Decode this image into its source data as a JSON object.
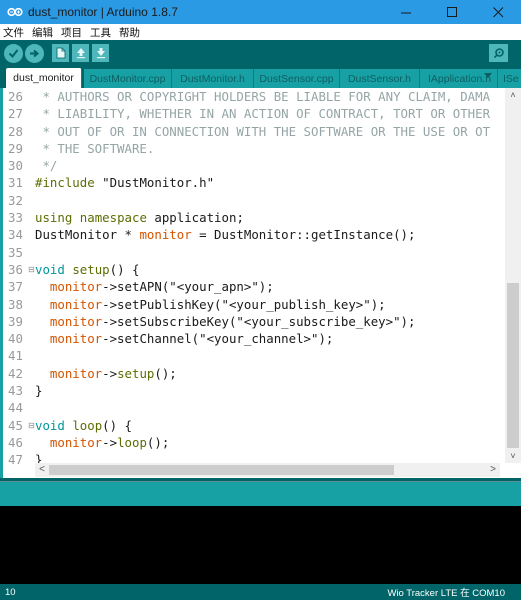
{
  "window": {
    "title": "dust_monitor | Arduino 1.8.7",
    "icon": "arduino-infinity-icon",
    "controls": {
      "minimize": "–",
      "maximize": "☐",
      "close": "✕"
    }
  },
  "menu": {
    "items": [
      "文件",
      "编辑",
      "项目",
      "工具",
      "帮助"
    ]
  },
  "toolbar": {
    "buttons": [
      {
        "name": "verify",
        "icon": "check-icon"
      },
      {
        "name": "upload",
        "icon": "arrow-right-icon"
      },
      {
        "name": "new",
        "icon": "file-icon"
      },
      {
        "name": "open",
        "icon": "arrow-up-icon"
      },
      {
        "name": "save",
        "icon": "arrow-down-icon"
      }
    ],
    "serial_monitor_icon": "magnifier-icon"
  },
  "tabs": [
    {
      "label": "dust_monitor",
      "active": true
    },
    {
      "label": "DustMonitor.cpp",
      "active": false
    },
    {
      "label": "DustMonitor.h",
      "active": false
    },
    {
      "label": "DustSensor.cpp",
      "active": false
    },
    {
      "label": "DustSensor.h",
      "active": false
    },
    {
      "label": "IApplication.h",
      "active": false
    },
    {
      "label": "ISe",
      "active": false
    }
  ],
  "editor": {
    "lines": [
      {
        "n": "26",
        "fold": false,
        "segs": [
          [
            "c-comment",
            " * AUTHORS OR COPYRIGHT HOLDERS BE LIABLE FOR ANY CLAIM, DAMA"
          ]
        ]
      },
      {
        "n": "27",
        "fold": false,
        "segs": [
          [
            "c-comment",
            " * LIABILITY, WHETHER IN AN ACTION OF CONTRACT, TORT OR OTHER"
          ]
        ]
      },
      {
        "n": "28",
        "fold": false,
        "segs": [
          [
            "c-comment",
            " * OUT OF OR IN CONNECTION WITH THE SOFTWARE OR THE USE OR OT"
          ]
        ]
      },
      {
        "n": "29",
        "fold": false,
        "segs": [
          [
            "c-comment",
            " * THE SOFTWARE."
          ]
        ]
      },
      {
        "n": "30",
        "fold": false,
        "segs": [
          [
            "c-comment",
            " */"
          ]
        ]
      },
      {
        "n": "31",
        "fold": false,
        "segs": [
          [
            "c-inc",
            "#include"
          ],
          [
            "c-plain",
            " \"DustMonitor.h\""
          ]
        ]
      },
      {
        "n": "32",
        "fold": false,
        "segs": []
      },
      {
        "n": "33",
        "fold": false,
        "segs": [
          [
            "c-inc",
            "using"
          ],
          [
            "c-plain",
            " "
          ],
          [
            "c-inc",
            "namespace"
          ],
          [
            "c-plain",
            " application;"
          ]
        ]
      },
      {
        "n": "34",
        "fold": false,
        "segs": [
          [
            "c-plain",
            "DustMonitor * "
          ],
          [
            "c-var",
            "monitor"
          ],
          [
            "c-plain",
            " = DustMonitor::getInstance();"
          ]
        ]
      },
      {
        "n": "35",
        "fold": false,
        "segs": []
      },
      {
        "n": "36",
        "fold": true,
        "segs": [
          [
            "c-kw",
            "void"
          ],
          [
            "c-plain",
            " "
          ],
          [
            "c-inc",
            "setup"
          ],
          [
            "c-plain",
            "() {"
          ]
        ]
      },
      {
        "n": "37",
        "fold": false,
        "segs": [
          [
            "c-plain",
            "  "
          ],
          [
            "c-var",
            "monitor"
          ],
          [
            "c-plain",
            "->setAPN(\"<your_apn>\");"
          ]
        ]
      },
      {
        "n": "38",
        "fold": false,
        "segs": [
          [
            "c-plain",
            "  "
          ],
          [
            "c-var",
            "monitor"
          ],
          [
            "c-plain",
            "->setPublishKey(\"<your_publish_key>\");"
          ]
        ]
      },
      {
        "n": "39",
        "fold": false,
        "segs": [
          [
            "c-plain",
            "  "
          ],
          [
            "c-var",
            "monitor"
          ],
          [
            "c-plain",
            "->setSubscribeKey(\"<your_subscribe_key>\");"
          ]
        ]
      },
      {
        "n": "40",
        "fold": false,
        "segs": [
          [
            "c-plain",
            "  "
          ],
          [
            "c-var",
            "monitor"
          ],
          [
            "c-plain",
            "->setChannel(\"<your_channel>\");"
          ]
        ]
      },
      {
        "n": "41",
        "fold": false,
        "segs": []
      },
      {
        "n": "42",
        "fold": false,
        "segs": [
          [
            "c-plain",
            "  "
          ],
          [
            "c-var",
            "monitor"
          ],
          [
            "c-plain",
            "->"
          ],
          [
            "c-inc",
            "setup"
          ],
          [
            "c-plain",
            "();"
          ]
        ]
      },
      {
        "n": "43",
        "fold": false,
        "segs": [
          [
            "c-plain",
            "}"
          ]
        ]
      },
      {
        "n": "44",
        "fold": false,
        "segs": []
      },
      {
        "n": "45",
        "fold": true,
        "segs": [
          [
            "c-kw",
            "void"
          ],
          [
            "c-plain",
            " "
          ],
          [
            "c-inc",
            "loop"
          ],
          [
            "c-plain",
            "() {"
          ]
        ]
      },
      {
        "n": "46",
        "fold": false,
        "segs": [
          [
            "c-plain",
            "  "
          ],
          [
            "c-var",
            "monitor"
          ],
          [
            "c-plain",
            "->"
          ],
          [
            "c-inc",
            "loop"
          ],
          [
            "c-plain",
            "();"
          ]
        ]
      },
      {
        "n": "47",
        "fold": false,
        "segs": [
          [
            "c-plain",
            "}"
          ]
        ]
      }
    ],
    "vscroll": {
      "up": "˄",
      "down": "˅"
    },
    "hscroll": {
      "left": "<",
      "right": ">"
    }
  },
  "status": {
    "line_number": "10",
    "board": "Wio Tracker LTE 在 COM10"
  },
  "colors": {
    "titlebar": "#2b9ae4",
    "toolbar": "#006468",
    "tab": "#17a1a5",
    "button": "#4db7bb",
    "console": "#000000"
  }
}
